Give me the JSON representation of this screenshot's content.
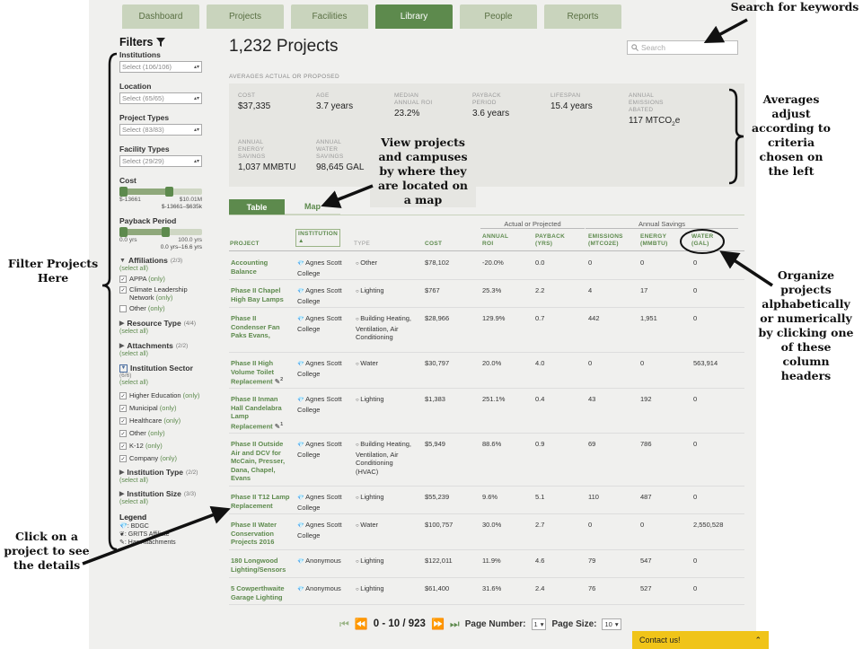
{
  "nav": {
    "tabs": [
      "Dashboard",
      "Projects",
      "Facilities",
      "Library",
      "People",
      "Reports"
    ],
    "active": "Library"
  },
  "sidebar": {
    "title": "Filters",
    "institutions": {
      "label": "Institutions",
      "value": "Select (106/106)"
    },
    "location": {
      "label": "Location",
      "value": "Select (65/65)"
    },
    "project_types": {
      "label": "Project Types",
      "value": "Select (83/83)"
    },
    "facility_types": {
      "label": "Facility Types",
      "value": "Select (29/29)"
    },
    "cost": {
      "label": "Cost",
      "min": "$-13661",
      "max": "$10.01M",
      "range": "$-13661–$635k"
    },
    "payback": {
      "label": "Payback Period",
      "min": "0.0 yrs",
      "max": "100.0 yrs",
      "range": "0.0 yrs–16.6 yrs"
    },
    "affiliations": {
      "label": "Affiliations",
      "count": "(2/3)",
      "select_all": "(select all)",
      "items": [
        "APPA",
        "Climate Leadership Network",
        "Other"
      ]
    },
    "resource_type": {
      "label": "Resource Type",
      "count": "(4/4)",
      "select_all": "(select all)"
    },
    "attachments": {
      "label": "Attachments",
      "count": "(2/2)",
      "select_all": "(select all)"
    },
    "institution_sector": {
      "label": "Institution Sector",
      "count": "(6/6)",
      "select_all": "(select all)",
      "items": [
        "Higher Education",
        "Municipal",
        "Healthcare",
        "Other",
        "K-12",
        "Company"
      ]
    },
    "institution_type": {
      "label": "Institution Type",
      "count": "(2/2)",
      "select_all": "(select all)"
    },
    "institution_size": {
      "label": "Institution Size",
      "count": "(3/3)",
      "select_all": "(select all)"
    },
    "only_text": "(only)",
    "legend": {
      "title": "Legend",
      "items": [
        ": BDGC",
        ": GRITS Affiliate",
        ": Has Attachments"
      ]
    }
  },
  "main": {
    "title": "1,232 Projects",
    "search_placeholder": "Search",
    "averages_label": "AVERAGES ACTUAL OR PROPOSED",
    "stats": {
      "cost": {
        "label": "COST",
        "value": "$37,335"
      },
      "age": {
        "label": "AGE",
        "value": "3.7 years"
      },
      "roi": {
        "label1": "MEDIAN",
        "label2": "ANNUAL ROI",
        "value": "23.2%"
      },
      "payback": {
        "label1": "PAYBACK",
        "label2": "PERIOD",
        "value": "3.6 years"
      },
      "lifespan": {
        "label": "LIFESPAN",
        "value": "15.4 years"
      },
      "emissions": {
        "label1": "ANNUAL",
        "label2": "EMISSIONS",
        "label3": "ABATED",
        "value": "117 MTCO",
        "sub": "2",
        "suffix": "e"
      },
      "energy": {
        "label1": "ANNUAL",
        "label2": "ENERGY",
        "label3": "SAVINGS",
        "value": "1,037 MMBTU"
      },
      "water": {
        "label1": "ANNUAL",
        "label2": "WATER",
        "label3": "SAVINGS",
        "value": "98,645 GAL"
      }
    },
    "view_tabs": [
      "Table",
      "Map"
    ],
    "group_headers": {
      "actual": "Actual or Projected",
      "annual": "Annual Savings"
    },
    "columns": {
      "project": "PROJECT",
      "institution": "INSTITUTION",
      "type": "TYPE",
      "cost": "COST",
      "roi1": "ANNUAL",
      "roi2": "ROI",
      "pay1": "PAYBACK",
      "pay2": "(YRS)",
      "em1": "EMISSIONS",
      "em2": "(MTCO2E)",
      "en1": "ENERGY",
      "en2": "(MMBTU)",
      "wa1": "WATER",
      "wa2": "(GAL)"
    },
    "rows": [
      {
        "project": "Accounting Balance",
        "institution": "Agnes Scott College",
        "type": "Other",
        "cost": "$78,102",
        "roi": "-20.0%",
        "payback": "0.0",
        "emissions": "0",
        "energy": "0",
        "water": "0"
      },
      {
        "project": "Phase II Chapel High Bay Lamps",
        "institution": "Agnes Scott College",
        "type": "Lighting",
        "cost": "$767",
        "roi": "25.3%",
        "payback": "2.2",
        "emissions": "4",
        "energy": "17",
        "water": "0"
      },
      {
        "project": "Phase II Condenser Fan Paks Evans,",
        "institution": "Agnes Scott College",
        "type": "Building Heating, Ventilation, Air Conditioning",
        "cost": "$28,966",
        "roi": "129.9%",
        "payback": "0.7",
        "emissions": "442",
        "energy": "1,951",
        "water": "0"
      },
      {
        "project": "Phase II High Volume Toilet Replacement",
        "institution": "Agnes Scott College",
        "type": "Water",
        "cost": "$30,797",
        "roi": "20.0%",
        "payback": "4.0",
        "emissions": "0",
        "energy": "0",
        "water": "563,914",
        "attach": "2"
      },
      {
        "project": "Phase II Inman Hall Candelabra Lamp Replacement",
        "institution": "Agnes Scott College",
        "type": "Lighting",
        "cost": "$1,383",
        "roi": "251.1%",
        "payback": "0.4",
        "emissions": "43",
        "energy": "192",
        "water": "0",
        "attach": "1"
      },
      {
        "project": "Phase II Outside Air and DCV for McCain, Presser, Dana, Chapel, Evans",
        "institution": "Agnes Scott College",
        "type": "Building Heating, Ventilation, Air Conditioning (HVAC)",
        "cost": "$5,949",
        "roi": "88.6%",
        "payback": "0.9",
        "emissions": "69",
        "energy": "786",
        "water": "0"
      },
      {
        "project": "Phase II T12 Lamp Replacement",
        "institution": "Agnes Scott College",
        "type": "Lighting",
        "cost": "$55,239",
        "roi": "9.6%",
        "payback": "5.1",
        "emissions": "110",
        "energy": "487",
        "water": "0"
      },
      {
        "project": "Phase II Water Conservation Projects 2016",
        "institution": "Agnes Scott College",
        "type": "Water",
        "cost": "$100,757",
        "roi": "30.0%",
        "payback": "2.7",
        "emissions": "0",
        "energy": "0",
        "water": "2,550,528"
      },
      {
        "project": "180 Longwood Lighting/Sensors",
        "institution": "Anonymous",
        "type": "Lighting",
        "cost": "$122,011",
        "roi": "11.9%",
        "payback": "4.6",
        "emissions": "79",
        "energy": "547",
        "water": "0"
      },
      {
        "project": "5 Cowperthwaite Garage Lighting",
        "institution": "Anonymous",
        "type": "Lighting",
        "cost": "$61,400",
        "roi": "31.6%",
        "payback": "2.4",
        "emissions": "76",
        "energy": "527",
        "water": "0"
      }
    ],
    "pager": {
      "range": "0 - 10 / 923",
      "page_label": "Page Number:",
      "page_value": "1",
      "size_label": "Page Size:",
      "size_value": "10"
    },
    "contact": "Contact us!"
  },
  "annotations": {
    "search": "Search for keywords",
    "averages": [
      "Averages",
      "adjust",
      "according to",
      "criteria",
      "chosen on",
      "the left"
    ],
    "map": [
      "View projects",
      "and campuses",
      "by where they",
      "are located on",
      "a map"
    ],
    "filter": [
      "Filter Projects",
      "Here"
    ],
    "organize": [
      "Organize",
      "projects",
      "alphabetically",
      "or numerically",
      "by clicking one",
      "of these",
      "column",
      "headers"
    ],
    "click": [
      "Click on a",
      "project to see",
      "the details"
    ]
  }
}
